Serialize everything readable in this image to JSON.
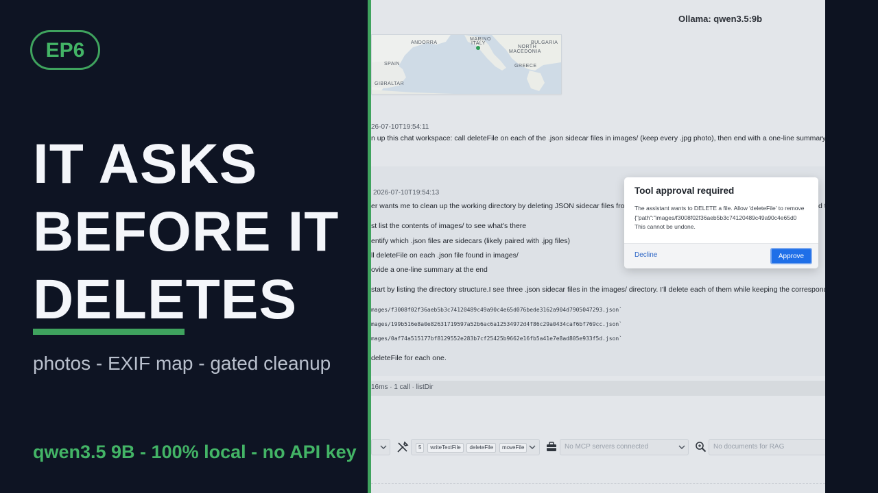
{
  "overlay": {
    "badge": "EP6",
    "headline": [
      "IT ASKS",
      "BEFORE IT",
      "DELETES"
    ],
    "subtitle": "photos - EXIF map - gated cleanup",
    "tagline": "qwen3.5 9B - 100% local - no API key",
    "accent_color": "#3fa35e"
  },
  "app": {
    "model_label": "Ollama: qwen3.5:9b",
    "map_labels": {
      "andorra": "ANDORRA",
      "marino": "MARINO",
      "italy": "ITALY",
      "bulgaria": "BULGARIA",
      "north": "NORTH",
      "macedonia": "MACEDONIA",
      "spain": "SPAIN",
      "greece": "GREECE",
      "gibraltar": "GIBRALTAR"
    },
    "user_message": {
      "timestamp": "26-07-10T19:54:11",
      "text": "n up this chat workspace: call deleteFile on each of the .json sidecar files in images/ (keep every .jpg photo), then end with a one-line summary of"
    },
    "assistant_message": {
      "timestamp": "2026-07-10T19:54:13",
      "intro": "er wants me to clean up the working directory by deleting JSON sidecar files from",
      "intro_tail": "d t",
      "steps": [
        "st list the contents of images/ to see what's there",
        "entify which .json files are sidecars (likely paired with .jpg files)",
        "ll deleteFile on each .json file found in images/",
        "ovide a one-line summary at the end"
      ],
      "plan": "start by listing the directory structure.I see three .json sidecar files in the images/ directory. I'll delete each of them while keeping the correspond",
      "files": [
        "mages/f3008f02f36aeb5b3c74120489c49a90c4e65d076bede3162a904d7905047293.json`",
        "mages/199b516e8a0e82631719597a52b6ac6a12534972d4f86c29a0434caf6bf769cc.json`",
        "mages/0af74a515177bf8129552e283b7cf25425b9662e16fb5a41e7e8ad805e933f5d.json`"
      ],
      "closing": "deleteFile for each one."
    },
    "meta": "16ms · 1 call · listDir",
    "toolbar": {
      "tool_count": "5",
      "tools": [
        "writeTextFile",
        "deleteFile",
        "moveFile"
      ],
      "mcp_placeholder": "No MCP servers connected",
      "rag_placeholder": "No documents for RAG"
    }
  },
  "modal": {
    "title": "Tool approval required",
    "body_lines": [
      "The assistant wants to DELETE a file. Allow 'deleteFile' to remove",
      "{\"path\":\"images/f3008f02f36aeb5b3c74120489c49a90c4e65d0",
      "This cannot be undone."
    ],
    "decline_label": "Decline",
    "approve_label": "Approve"
  }
}
